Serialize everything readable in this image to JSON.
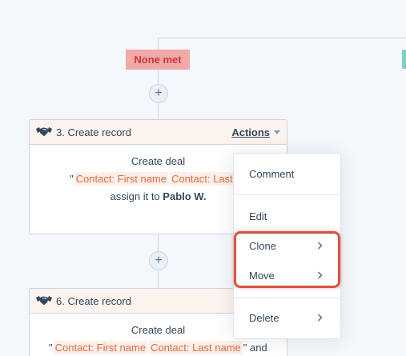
{
  "branch": {
    "label": "None met"
  },
  "plus_symbol": "+",
  "cards": [
    {
      "title": "3. Create record",
      "actions_label": "Actions",
      "line1": "Create deal",
      "quote_open": "\"",
      "token1": "Contact: First name",
      "token2": "Contact: Last name",
      "assign_prefix": "assign it to",
      "owner": "Pablo W."
    },
    {
      "title": "6. Create record",
      "line1": "Create deal",
      "quote_open": "\"",
      "token1": "Contact: First name",
      "token2": "Contact: Last name",
      "tail": "\" and"
    }
  ],
  "menu": {
    "items": [
      {
        "label": "Comment"
      },
      {
        "label": "Edit"
      },
      {
        "label": "Clone"
      },
      {
        "label": "Move"
      },
      {
        "label": "Delete"
      }
    ]
  },
  "colors": {
    "branch_bg": "#f2a8a8",
    "branch_text": "#c93a3a",
    "token": "#e5683c",
    "highlight": "#d9553f",
    "teal": "#7fd1c7"
  }
}
